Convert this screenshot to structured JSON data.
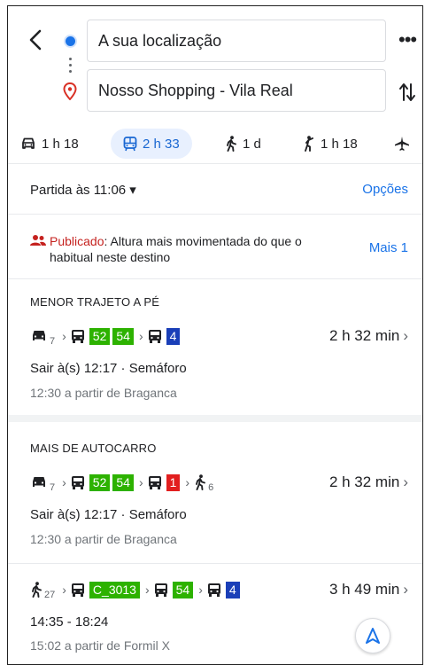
{
  "header": {
    "origin": "A sua localização",
    "destination": "Nosso Shopping - Vila Real"
  },
  "modes": [
    {
      "icon": "car-icon",
      "label": "1 h 18"
    },
    {
      "icon": "transit-icon",
      "label": "2 h 33",
      "selected": true
    },
    {
      "icon": "walk-icon",
      "label": "1 d"
    },
    {
      "icon": "rideshare-icon",
      "label": "1 h 18"
    },
    {
      "icon": "flight-icon",
      "label": ""
    }
  ],
  "depart": {
    "label": "Partida às 11:06 ▾",
    "options": "Opções"
  },
  "alert": {
    "highlight": "Publicado",
    "text": ": Altura mais movimentada do que o",
    "text2": "habitual neste destino",
    "more": "Mais 1"
  },
  "routes": [
    {
      "section": "MENOR TRAJETO A PÉ",
      "car_sub": "7",
      "badges_a": [
        "52",
        "54"
      ],
      "badges_b": [
        "4"
      ],
      "duration": "2 h 32 min",
      "line1": "Sair à(s) 12:17 · Semáforo",
      "line2": "12:30 a partir de Braganca"
    },
    {
      "section": "MAIS DE AUTOCARRO",
      "car_sub": "7",
      "badges_a": [
        "52",
        "54"
      ],
      "badges_b": [
        "1"
      ],
      "walk_sub": "6",
      "duration": "2 h 32 min",
      "line1": "Sair à(s) 12:17 · Semáforo",
      "line2": "12:30 a partir de Braganca"
    },
    {
      "walk_sub": "27",
      "badges_a": [
        "C_3013"
      ],
      "badges_b": [
        "54"
      ],
      "badges_c": [
        "4"
      ],
      "duration": "3 h 49 min",
      "line1": "14:35 - 18:24",
      "line2": "15:02 a partir de Formil X"
    }
  ],
  "colors": {
    "accent": "#1a73e8",
    "green_badge": "#2db200",
    "blue_badge": "#1a3fb8",
    "red_badge": "#e21f1f",
    "alert": "#c5221f"
  }
}
